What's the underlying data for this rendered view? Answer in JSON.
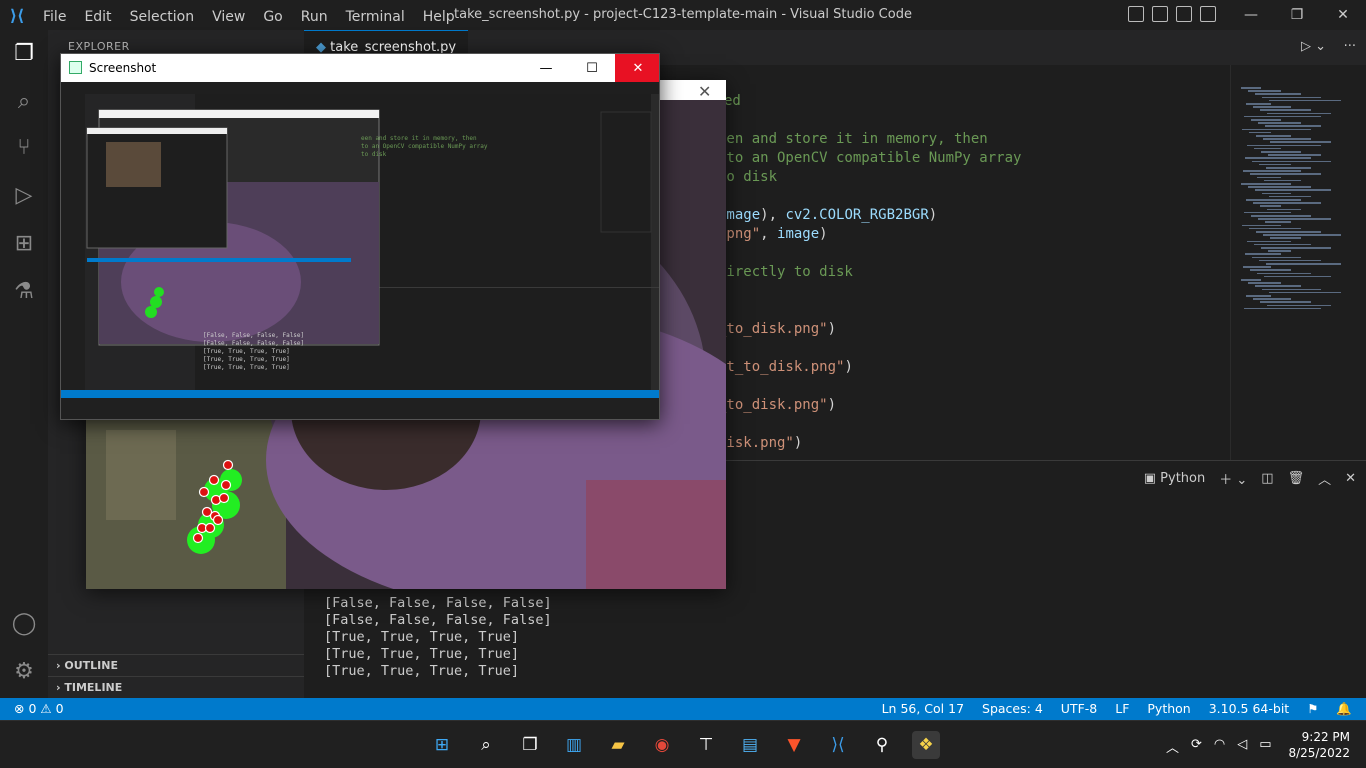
{
  "titlebar": {
    "menu": [
      "File",
      "Edit",
      "Selection",
      "View",
      "Go",
      "Run",
      "Terminal",
      "Help"
    ],
    "title": "take_screenshot.py - project-C123-template-main - Visual Studio Code"
  },
  "sidebar": {
    "header": "EXPLORER",
    "outline": "OUTLINE",
    "timeline": "TIMELINE"
  },
  "tab": {
    "label": "take_screenshot.py"
  },
  "editor": {
    "lines": [
      {
        "parts": [
          {
            "c": "cmt",
            "t": "ed"
          }
        ]
      },
      {
        "parts": [
          {
            "c": "cmt",
            "t": "een and store it in memory, then"
          }
        ]
      },
      {
        "parts": [
          {
            "c": "cmt",
            "t": " to an OpenCV compatible NumPy array"
          }
        ]
      },
      {
        "parts": [
          {
            "c": "cmt",
            "t": "to disk"
          }
        ]
      },
      {
        "parts": [
          {
            "c": "var",
            "t": "image"
          },
          {
            "c": "pln",
            "t": "), "
          },
          {
            "c": "var",
            "t": "cv2.COLOR_RGB2BGR"
          },
          {
            "c": "pln",
            "t": ")"
          }
        ]
      },
      {
        "parts": [
          {
            "c": "str",
            "t": ".png\""
          },
          {
            "c": "pln",
            "t": ", "
          },
          {
            "c": "var",
            "t": "image"
          },
          {
            "c": "pln",
            "t": ")"
          }
        ]
      },
      {
        "parts": [
          {
            "c": "cmt",
            "t": "directly to disk"
          }
        ]
      },
      {
        "parts": [
          {
            "c": "str",
            "t": "_to_disk.png\""
          },
          {
            "c": "pln",
            "t": ")"
          }
        ]
      },
      {
        "parts": [
          {
            "c": "str",
            "t": "ht_to_disk.png\""
          },
          {
            "c": "pln",
            "t": ")"
          }
        ]
      },
      {
        "parts": [
          {
            "c": "str",
            "t": "_to_disk.png\""
          },
          {
            "c": "pln",
            "t": ")"
          }
        ]
      },
      {
        "parts": [
          {
            "c": "str",
            "t": "disk.png\""
          },
          {
            "c": "pln",
            "t": ")"
          }
        ]
      }
    ]
  },
  "panel": {
    "terminal_label": "Python",
    "output": [
      "[False, False, False, False]",
      "[False, False, False, False]",
      "[True, True, True, True]",
      "[True, True, True, True]",
      "[True, True, True, True]"
    ]
  },
  "status": {
    "errors": "0",
    "warnings": "0",
    "position": "Ln 56, Col 17",
    "spaces": "Spaces: 4",
    "encoding": "UTF-8",
    "eol": "LF",
    "language": "Python",
    "interpreter": "3.10.5 64-bit"
  },
  "taskbar": {
    "time": "9:22 PM",
    "date": "8/25/2022"
  },
  "screenshot_window": {
    "title": "Screenshot"
  },
  "icons": {
    "explorer": "files-icon",
    "search": "search-icon",
    "scm": "source-control-icon",
    "debug": "run-debug-icon",
    "extensions": "extensions-icon",
    "testing": "flask-icon",
    "account": "account-icon",
    "settings": "gear-icon"
  }
}
